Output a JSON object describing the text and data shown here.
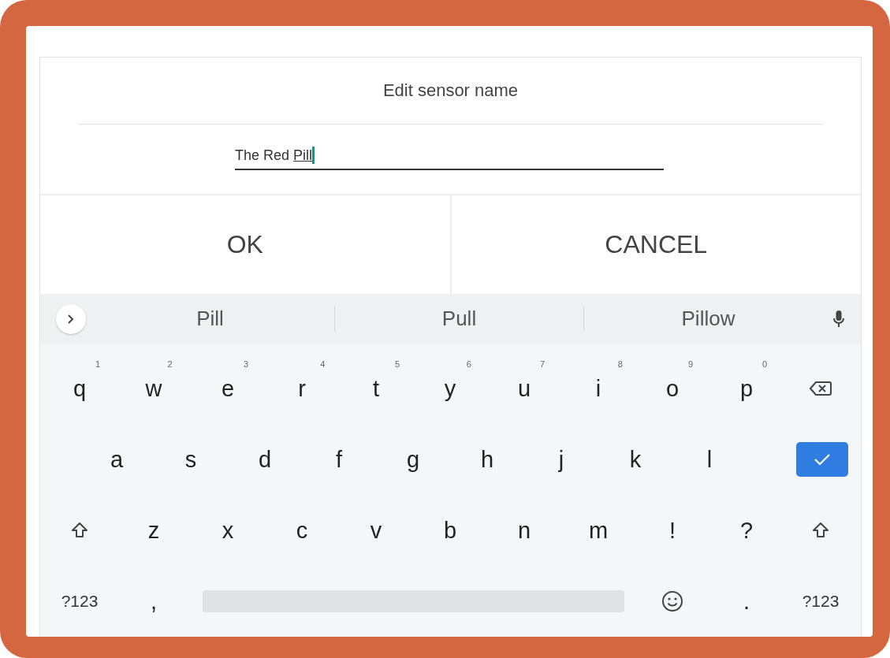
{
  "dialog": {
    "title": "Edit sensor name",
    "field": {
      "text": "The Red",
      "composing": "Pill",
      "focused": true
    },
    "buttons": [
      "OK",
      "CANCEL"
    ]
  },
  "keyboard": {
    "suggestions": [
      "Pill",
      "Pull",
      "Pillow"
    ],
    "rows": [
      [
        {
          "kind": "letter",
          "label": "q",
          "hint": "1"
        },
        {
          "kind": "letter",
          "label": "w",
          "hint": "2"
        },
        {
          "kind": "letter",
          "label": "e",
          "hint": "3"
        },
        {
          "kind": "letter",
          "label": "r",
          "hint": "4"
        },
        {
          "kind": "letter",
          "label": "t",
          "hint": "5"
        },
        {
          "kind": "letter",
          "label": "y",
          "hint": "6"
        },
        {
          "kind": "letter",
          "label": "u",
          "hint": "7"
        },
        {
          "kind": "letter",
          "label": "i",
          "hint": "8"
        },
        {
          "kind": "letter",
          "label": "o",
          "hint": "9"
        },
        {
          "kind": "letter",
          "label": "p",
          "hint": "0"
        },
        {
          "kind": "backspace"
        }
      ],
      [
        {
          "kind": "letter",
          "label": "a"
        },
        {
          "kind": "letter",
          "label": "s"
        },
        {
          "kind": "letter",
          "label": "d"
        },
        {
          "kind": "letter",
          "label": "f"
        },
        {
          "kind": "letter",
          "label": "g"
        },
        {
          "kind": "letter",
          "label": "h"
        },
        {
          "kind": "letter",
          "label": "j"
        },
        {
          "kind": "letter",
          "label": "k"
        },
        {
          "kind": "letter",
          "label": "l"
        },
        {
          "kind": "enter"
        }
      ],
      [
        {
          "kind": "shift"
        },
        {
          "kind": "letter",
          "label": "z"
        },
        {
          "kind": "letter",
          "label": "x"
        },
        {
          "kind": "letter",
          "label": "c"
        },
        {
          "kind": "letter",
          "label": "v"
        },
        {
          "kind": "letter",
          "label": "b"
        },
        {
          "kind": "letter",
          "label": "n"
        },
        {
          "kind": "letter",
          "label": "m"
        },
        {
          "kind": "letter",
          "label": "!"
        },
        {
          "kind": "letter",
          "label": "?"
        },
        {
          "kind": "shift"
        }
      ]
    ],
    "bottom_row": {
      "symbols_left": "?123",
      "comma": ",",
      "period": ".",
      "symbols_right": "?123"
    }
  }
}
